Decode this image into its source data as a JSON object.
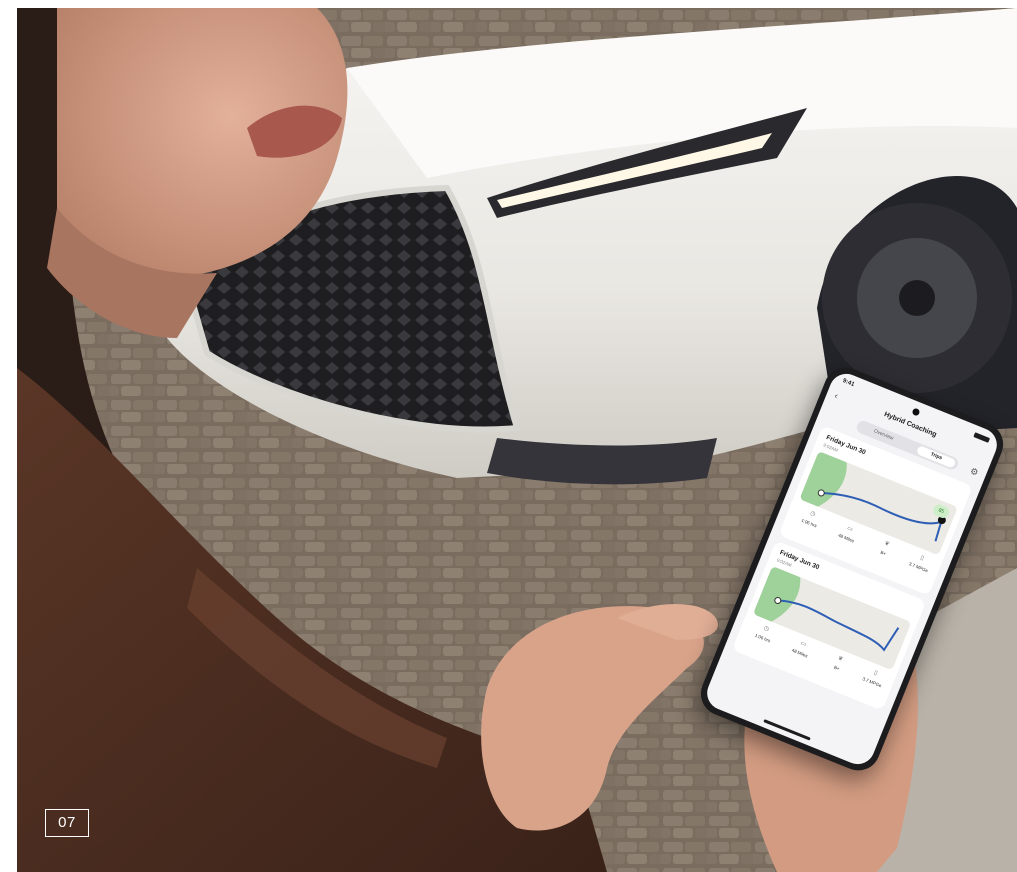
{
  "photo": {
    "subject": "woman-holding-smartphone-near-white-suv",
    "colors": {
      "car_paint": "#f2f1ee",
      "pavement": "#7d7062",
      "jacket": "#4a2d22",
      "skin": "#d9a38a",
      "hair": "#2a1c16",
      "phone_body": "#1c1c1e"
    }
  },
  "phone_app": {
    "status_time": "9:41",
    "header_title": "Hybrid Coaching",
    "tabs": [
      "Overview",
      "Trips"
    ],
    "active_tab": "Trips",
    "trips": [
      {
        "date": "Friday Jun 30",
        "subtitle": "9:02AM",
        "score": "85",
        "stats": [
          "1:06 hrs",
          "48 Miles",
          "B+",
          "3.7 MPGe"
        ]
      },
      {
        "date": "Friday Jun 30",
        "subtitle": "9:02AM",
        "score": "",
        "stats": [
          "1:06 hrs",
          "48 Miles",
          "B+",
          "3.7 MPGe"
        ]
      }
    ]
  },
  "page_badge": "07"
}
